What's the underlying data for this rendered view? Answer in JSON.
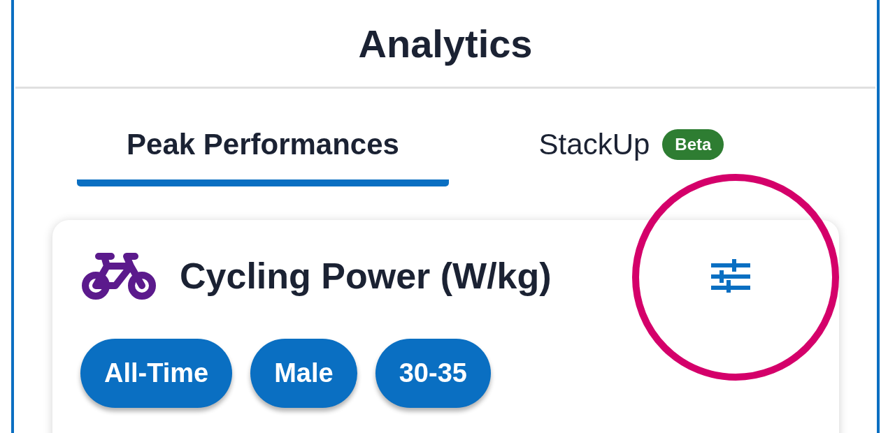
{
  "header": {
    "title": "Analytics"
  },
  "tabs": [
    {
      "label": "Peak Performances",
      "selected": true
    },
    {
      "label": "StackUp",
      "selected": false,
      "badge": "Beta"
    }
  ],
  "card": {
    "title": "Cycling Power (W/kg)",
    "filters_highlighted": true,
    "chips": [
      "All-Time",
      "Male",
      "30-35"
    ]
  }
}
